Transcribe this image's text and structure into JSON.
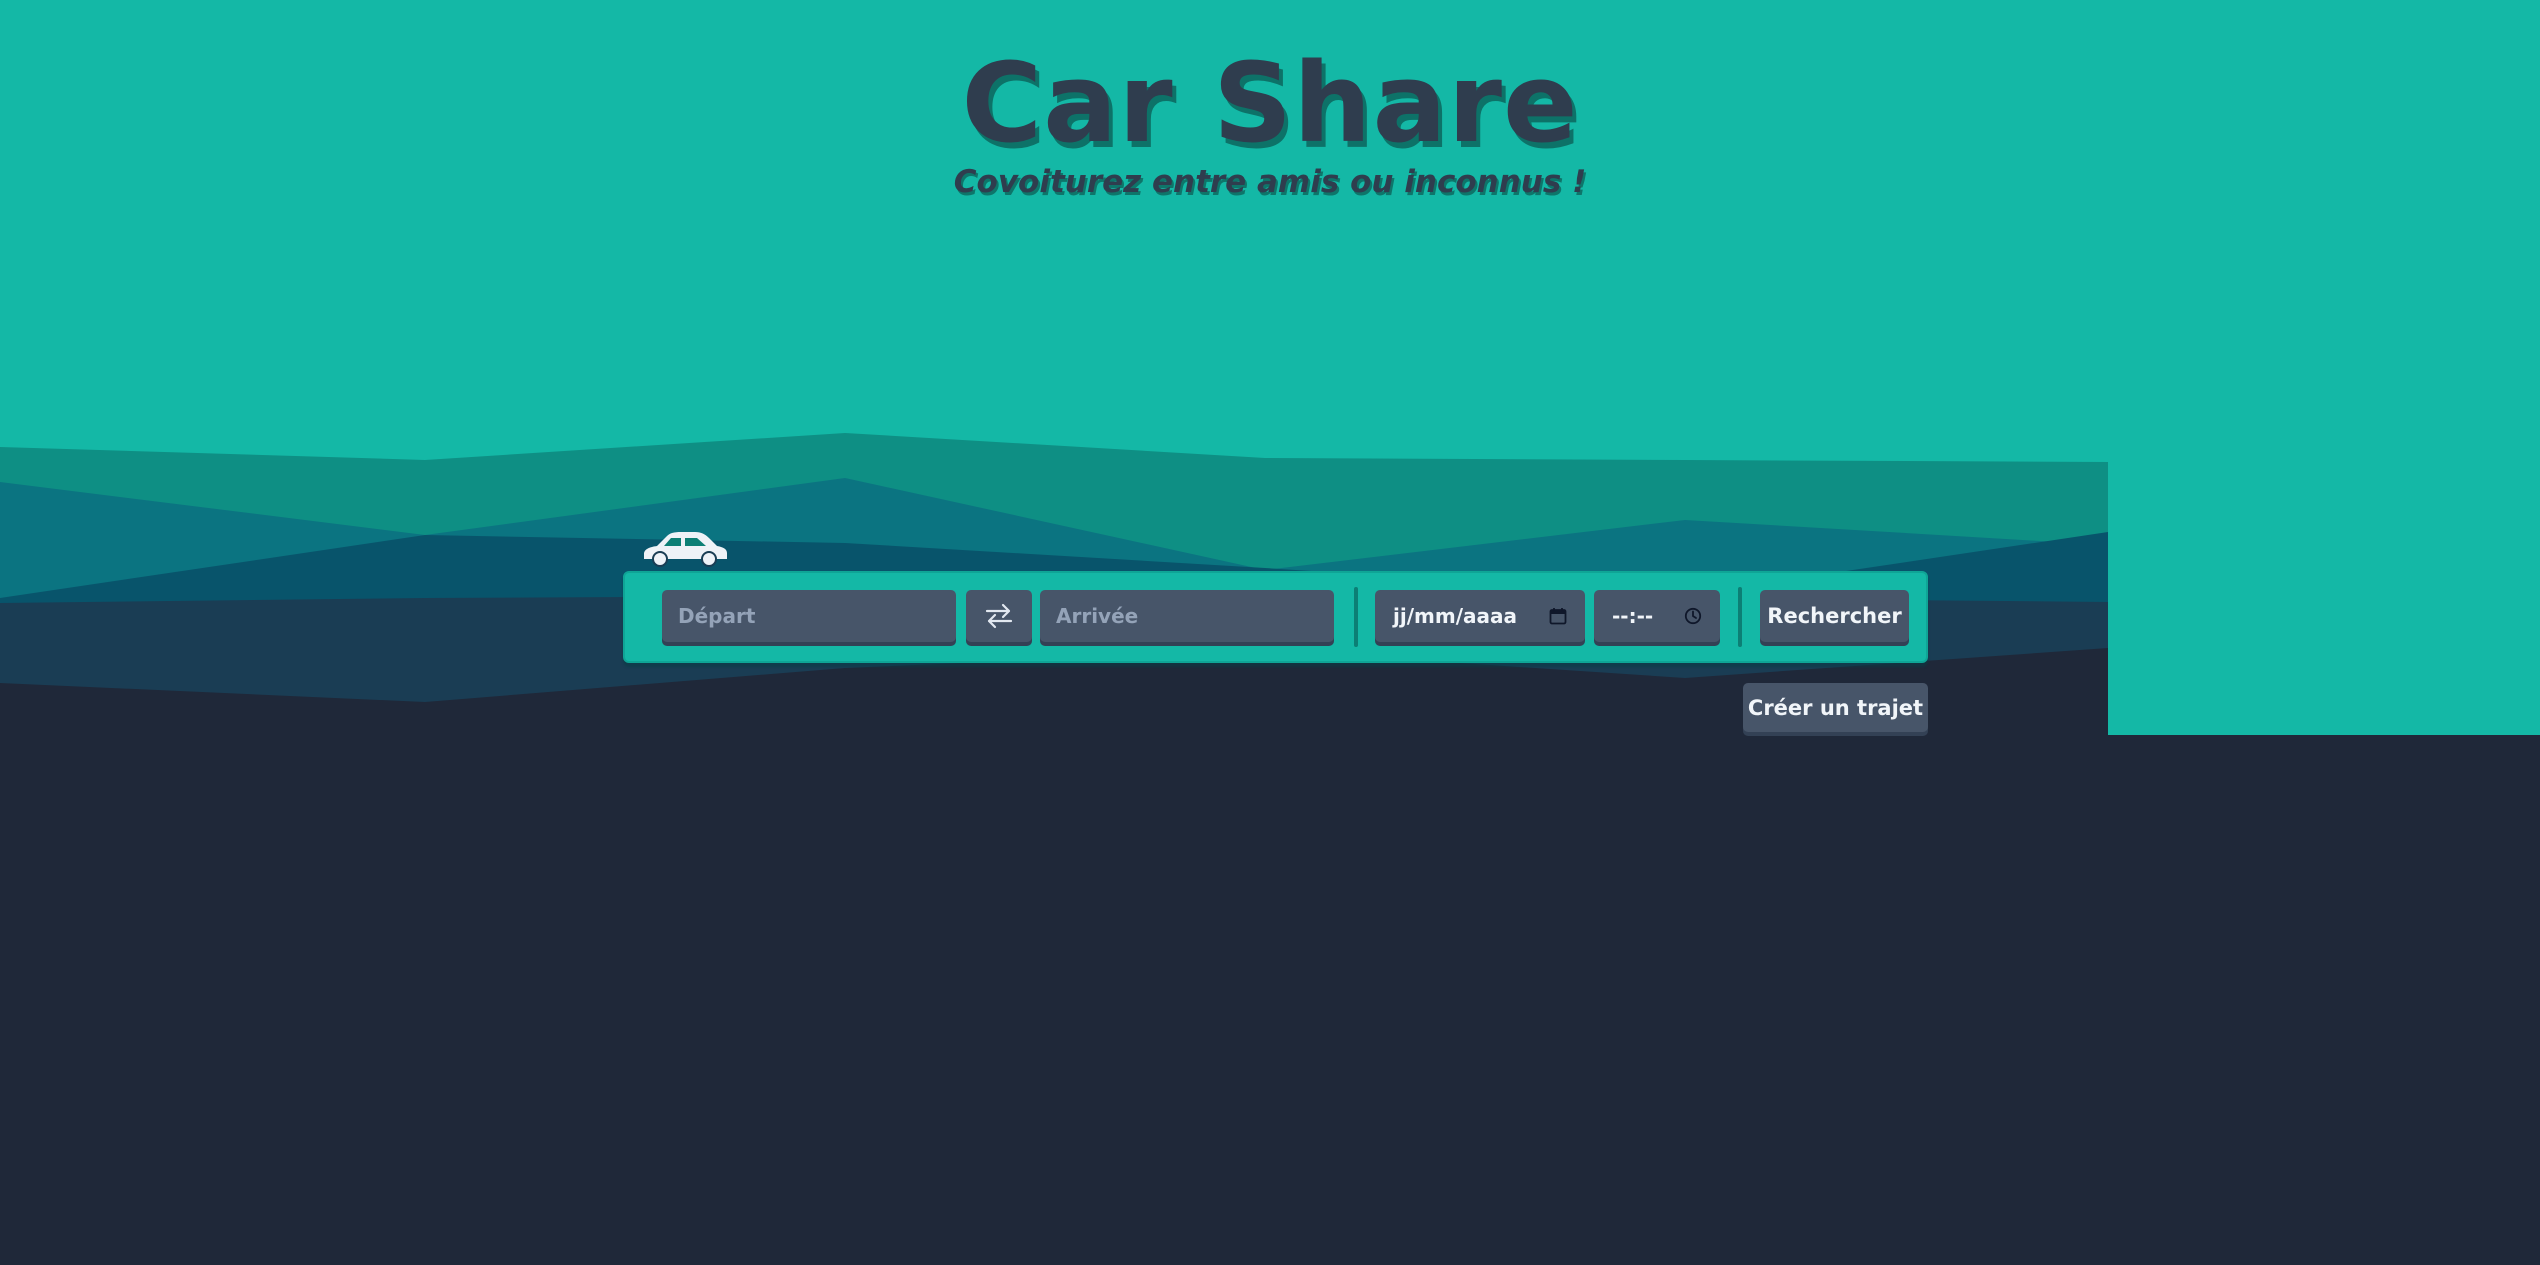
{
  "header": {
    "title": "Car Share",
    "subtitle": "Covoiturez entre amis ou inconnus !"
  },
  "search": {
    "depart_placeholder": "Départ",
    "arrivee_placeholder": "Arrivée",
    "date_value": "jj/mm/aaaa",
    "time_value": "--:--",
    "submit_label": "Rechercher"
  },
  "actions": {
    "create_label": "Créer un trajet"
  },
  "icons": {
    "swap": "swap-arrows-icon",
    "calendar": "calendar-icon",
    "clock": "clock-icon",
    "car": "car-icon"
  },
  "colors": {
    "accent": "#14b8a6",
    "background": "#1f2839",
    "control": "#475569"
  }
}
